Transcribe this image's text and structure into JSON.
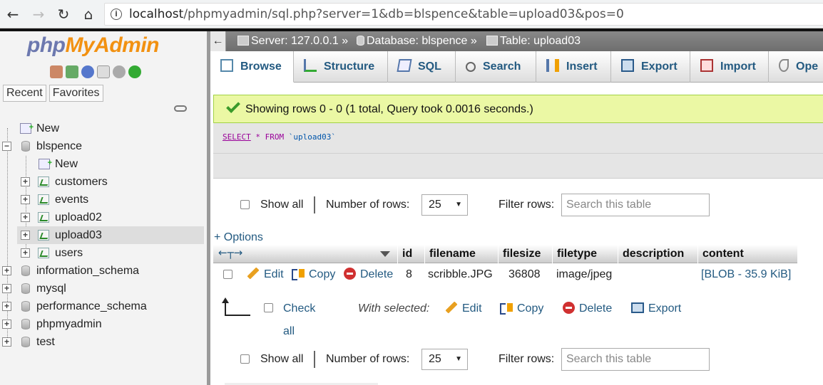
{
  "browser": {
    "url_host": "localhost",
    "url_path": "/phpmyadmin/sql.php?server=1&db=blspence&table=upload03&pos=0"
  },
  "logo": {
    "php": "php",
    "my": "My",
    "admin": "Admin"
  },
  "sidebar": {
    "tabs": [
      "Recent",
      "Favorites"
    ],
    "tree": {
      "new_top": "New",
      "db_current": "blspence",
      "db_new": "New",
      "tables": [
        "customers",
        "events",
        "upload02",
        "upload03",
        "users"
      ],
      "selected_table": "upload03",
      "other_dbs": [
        "information_schema",
        "mysql",
        "performance_schema",
        "phpmyadmin",
        "test"
      ]
    }
  },
  "breadcrumb": {
    "server": "Server: 127.0.0.1 »",
    "database": "Database: blspence »",
    "table": "Table: upload03"
  },
  "tabs": [
    "Browse",
    "Structure",
    "SQL",
    "Search",
    "Insert",
    "Export",
    "Import",
    "Ope"
  ],
  "active_tab": "Browse",
  "result": {
    "message": "Showing rows 0 - 0 (1 total, Query took 0.0016 seconds.)",
    "sql_select": "SELECT",
    "sql_rest": " * FROM ",
    "sql_table": "`upload03`"
  },
  "nav": {
    "show_all": "Show all",
    "rows_label": "Number of rows:",
    "rows_value": "25",
    "filter_label": "Filter rows:",
    "filter_placeholder": "Search this table"
  },
  "options_link": "+ Options",
  "table": {
    "columns": [
      "id",
      "filename",
      "filesize",
      "filetype",
      "description",
      "content"
    ],
    "row": {
      "edit": "Edit",
      "copy": "Copy",
      "delete": "Delete",
      "id": "8",
      "filename": "scribble.JPG",
      "filesize": "36808",
      "filetype": "image/jpeg",
      "description": "",
      "content": "[BLOB - 35.9 KiB]"
    }
  },
  "with_selected": {
    "check_all": "Check all",
    "label": "With selected:",
    "edit": "Edit",
    "copy": "Copy",
    "delete": "Delete",
    "export": "Export"
  },
  "colors": {
    "link": "#235a81",
    "success_bg": "#ebf8a4",
    "breadcrumb_bg": "#777777",
    "logo_php": "#6c78af",
    "logo_myadmin": "#f29111"
  }
}
